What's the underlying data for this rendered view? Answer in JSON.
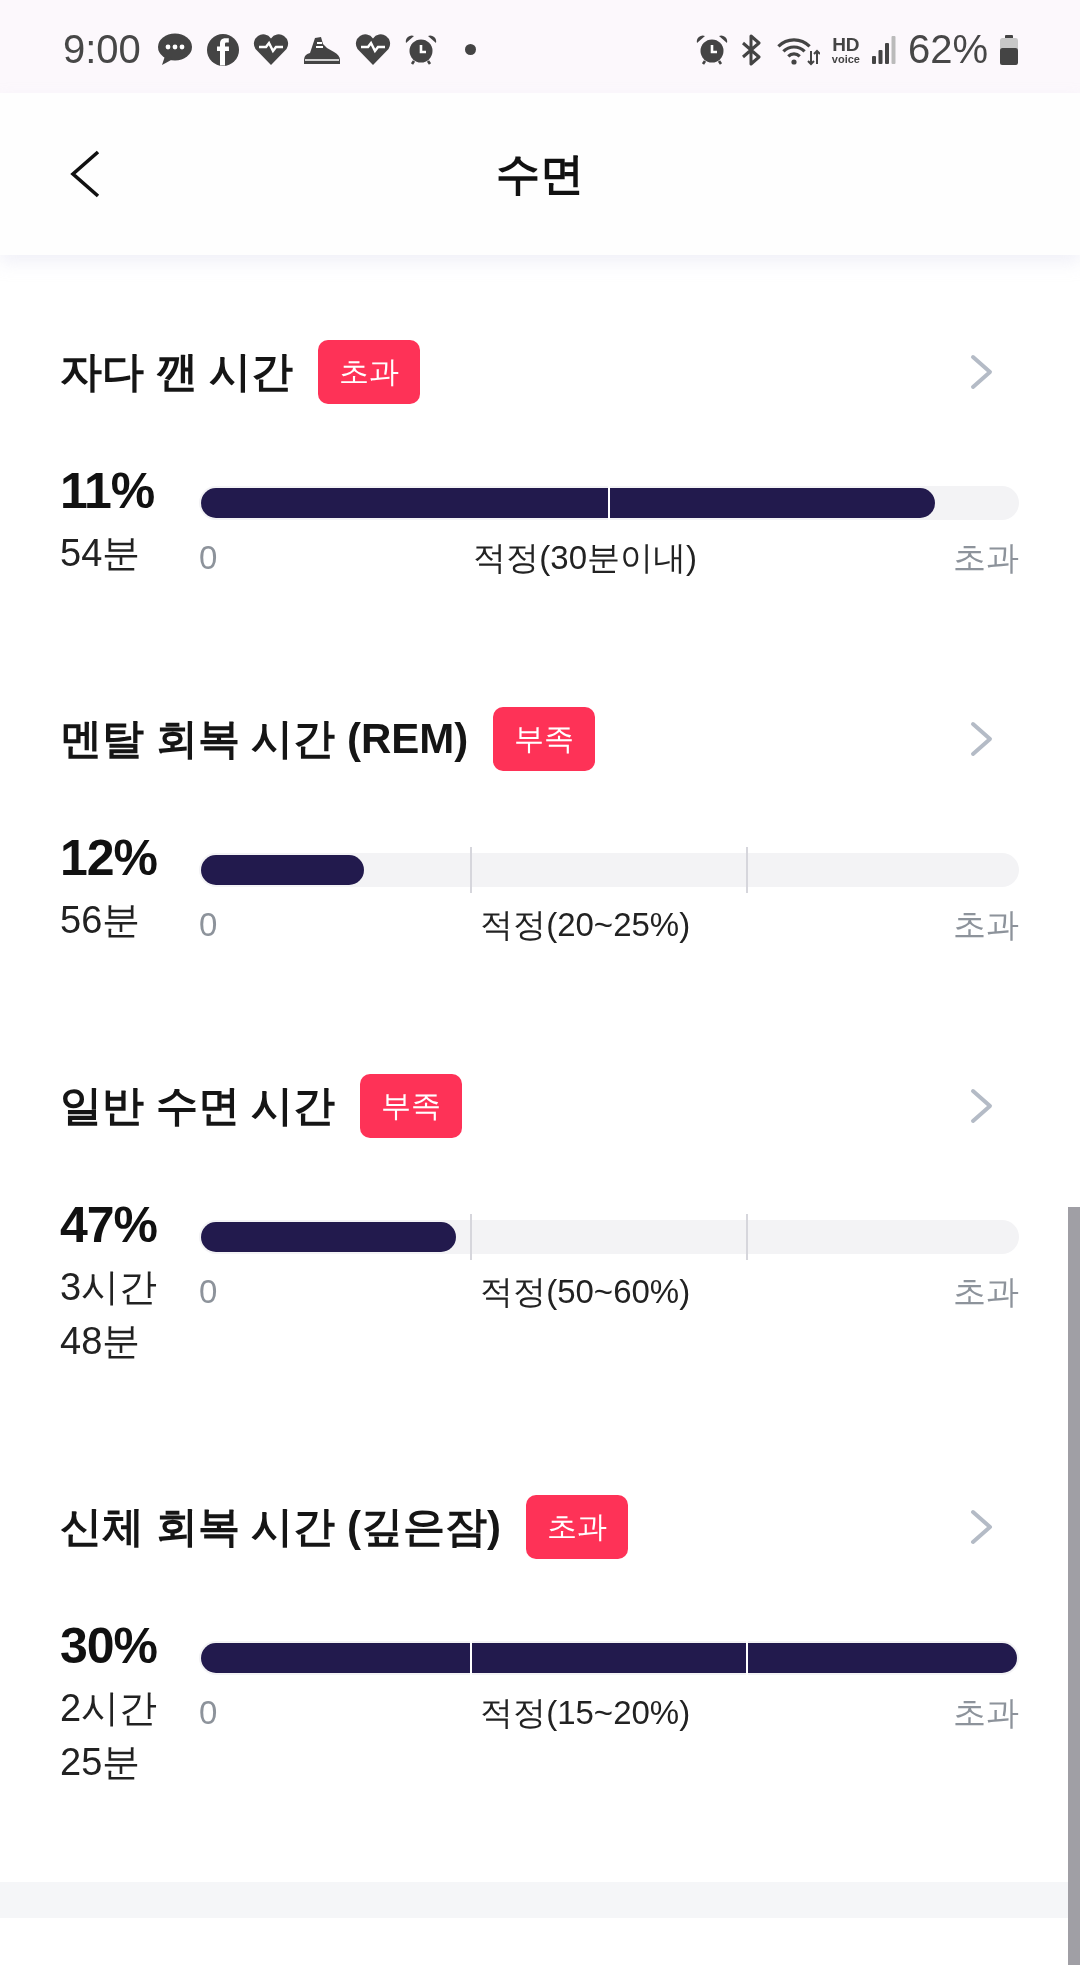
{
  "status_bar": {
    "time": "9:00",
    "hd_label": "HD",
    "voice_label": "voice",
    "battery": "62%"
  },
  "header": {
    "title": "수면"
  },
  "sections": [
    {
      "kind": "limit",
      "title": "자다 깬 시간",
      "badge": "초과",
      "percent": "11%",
      "duration": "54분",
      "level": 0.9,
      "scale": {
        "start": "0",
        "target": "적정(30분이내)",
        "end": "초과"
      }
    },
    {
      "kind": "range",
      "title": "멘탈 회복 시간 (REM)",
      "badge": "부족",
      "percent": "12%",
      "duration": "56분",
      "level": 0.2,
      "scale": {
        "start": "0",
        "target": "적정(20~25%)",
        "end": "초과"
      }
    },
    {
      "kind": "range",
      "title": "일반 수면 시간",
      "badge": "부족",
      "percent": "47%",
      "duration": "3시간 48분",
      "level": 0.313,
      "scale": {
        "start": "0",
        "target": "적정(50~60%)",
        "end": "초과"
      }
    },
    {
      "kind": "range",
      "title": "신체 회복 시간 (깊은잠)",
      "badge": "초과",
      "percent": "30%",
      "duration": "2시간 25분",
      "level": 1,
      "scale": {
        "start": "0",
        "target": "적정(15~20%)",
        "end": "초과"
      }
    }
  ]
}
